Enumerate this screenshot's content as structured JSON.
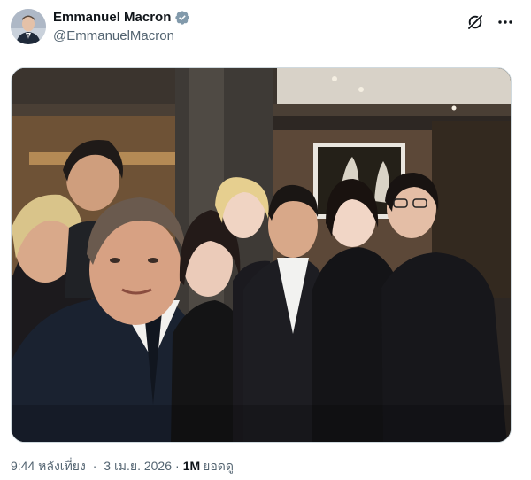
{
  "author": {
    "display_name": "Emmanuel Macron",
    "handle": "@EmmanuelMacron",
    "verified": true,
    "verified_color": "#829aab",
    "avatar_icon": "profile-photo"
  },
  "header_actions": {
    "grok_icon": "grok-icon",
    "more_icon": "more-icon"
  },
  "media": {
    "type": "photo",
    "icon": "group-selfie-photo"
  },
  "meta": {
    "time": "9:44 หลังเที่ยง",
    "separator": "·",
    "date": "3 เม.ย. 2026",
    "views_count": "1M",
    "views_label": "ยอดดู"
  }
}
